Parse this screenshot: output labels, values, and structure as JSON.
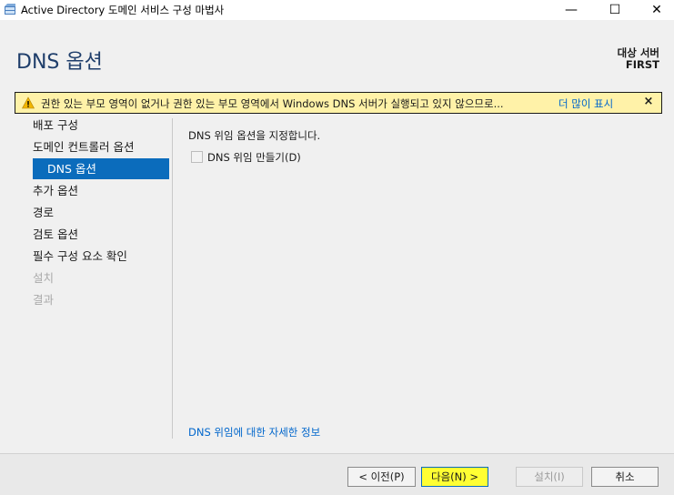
{
  "window": {
    "title": "Active Directory 도메인 서비스 구성 마법사",
    "minimize_glyph": "—",
    "maximize_glyph": "☐",
    "close_glyph": "✕"
  },
  "header": {
    "page_title": "DNS 옵션",
    "target_label": "대상 서버",
    "target_name": "FIRST"
  },
  "banner": {
    "icon": "warning-icon",
    "text": "권한 있는 부모 영역이 없거나 권한 있는 부모 영역에서 Windows DNS 서버가 실행되고 있지 않으므로...",
    "link": "더 많이 표시",
    "close": "×",
    "colors": {
      "background": "#fff2a8",
      "warning": "#f2b600"
    }
  },
  "nav": {
    "items": [
      {
        "label": "배포 구성",
        "state": "normal"
      },
      {
        "label": "도메인 컨트롤러 옵션",
        "state": "normal"
      },
      {
        "label": "DNS 옵션",
        "state": "active"
      },
      {
        "label": "추가 옵션",
        "state": "normal"
      },
      {
        "label": "경로",
        "state": "normal"
      },
      {
        "label": "검토 옵션",
        "state": "normal"
      },
      {
        "label": "필수 구성 요소 확인",
        "state": "normal"
      },
      {
        "label": "설치",
        "state": "disabled"
      },
      {
        "label": "결과",
        "state": "disabled"
      }
    ],
    "active_color": "#0b6cbc"
  },
  "content": {
    "heading": "DNS 위임 옵션을 지정합니다.",
    "checkbox_label": "DNS 위임 만들기(D)",
    "checkbox_checked": false,
    "more_info_link": "DNS 위임에 대한 자세한 정보"
  },
  "footer": {
    "prev": "< 이전(P)",
    "next": "다음(N) >",
    "install": "설치(I)",
    "cancel": "취소"
  }
}
